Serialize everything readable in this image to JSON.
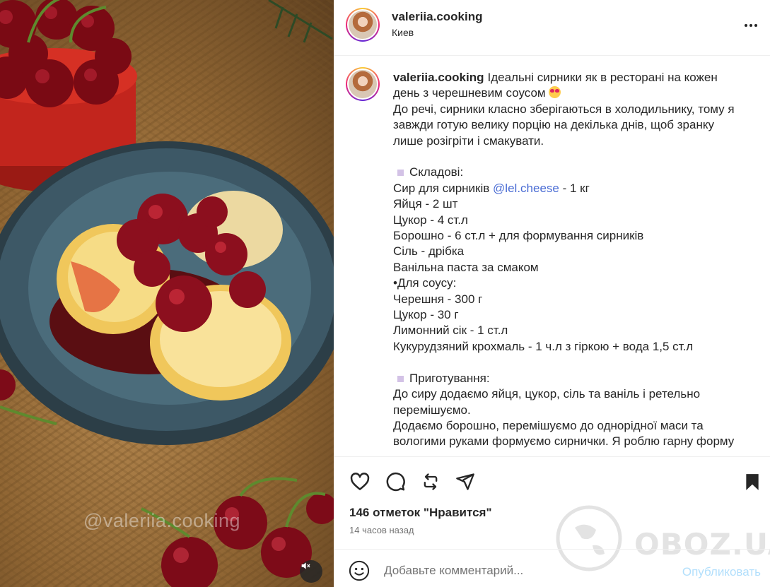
{
  "post": {
    "author": "valeriia.cooking",
    "location": "Киев",
    "caption_lines": [
      "Ідеальні сирники як в ресторані на кожен",
      "день з черешневим соусом",
      "До речі, сирники класно зберігаються в холодильнику, тому я",
      "завжди готую велику порцію на декілька днів, щоб зранку",
      "лише розігріти і смакувати.",
      "",
      "Складові:",
      "Сир для сирників",
      "Яйця - 2 шт",
      "Цукор - 4 ст.л",
      "Борошно - 6 ст.л + для формування сирників",
      "Сіль - дрібка",
      "Ванільна паста за смаком",
      "•Для соусу:",
      "Черешня - 300 г",
      "Цукор - 30 г",
      "Лимонний сік - 1 ст.л",
      "Кукурудзяний крохмаль - 1 ч.л з гіркою + вода 1,5 ст.л",
      "",
      "Приготування:",
      "До сиру додаємо яйця, цукор, сіль та ваніль і ретельно",
      "перемішуємо.",
      "Додаємо борошно, перемішуємо до однорідної маси та",
      "вологими руками формуємо сирнички. Я роблю гарну форму"
    ],
    "mention": "@lel.cheese",
    "mention_suffix": " - 1 кг",
    "likes": "146 отметок \"Нравится\"",
    "time_ago": "14 часов назад"
  },
  "photo": {
    "watermark": "@valeriia.cooking"
  },
  "comment": {
    "placeholder": "Добавьте комментарий...",
    "publish_label": "Опубликовать"
  },
  "watermark_site": "OBOZ.UA",
  "icons": {
    "like": "heart-icon",
    "comment": "comment-icon",
    "repost": "repost-icon",
    "share": "send-icon",
    "save": "bookmark-icon",
    "emoji": "smiley-icon",
    "more": "more-dots-icon",
    "mute": "muted-speaker-icon"
  },
  "colors": {
    "mention": "#4a6cd4",
    "publish": "#b2dffc",
    "secondary_text": "#737373",
    "divider": "#efefef"
  }
}
